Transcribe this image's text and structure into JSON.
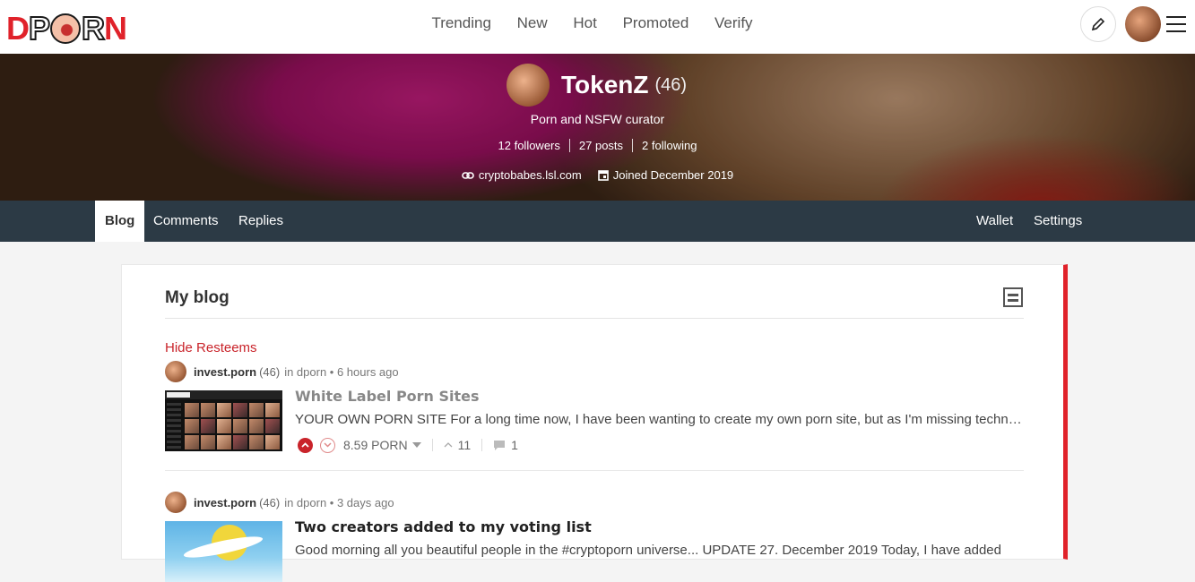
{
  "header": {
    "logo_text": "DPORN",
    "nav": [
      "Trending",
      "New",
      "Hot",
      "Promoted",
      "Verify"
    ],
    "compose_icon": "pencil-icon",
    "menu_icon": "hamburger-icon"
  },
  "profile": {
    "name": "TokenZ",
    "reputation": "(46)",
    "about": "Porn and NSFW curator",
    "followers": "12 followers",
    "posts": "27 posts",
    "following": "2 following",
    "website": "cryptobabes.lsl.com",
    "joined": "Joined December 2019"
  },
  "tabs": {
    "left": [
      "Blog",
      "Comments",
      "Replies"
    ],
    "right": [
      "Wallet",
      "Settings"
    ],
    "active": "Blog"
  },
  "blog": {
    "title": "My blog",
    "hide_resteems": "Hide Resteems",
    "posts": [
      {
        "author": "invest.porn",
        "reputation": "(46)",
        "meta": "in dporn • 6 hours ago",
        "title": "White Label Porn Sites",
        "body": "YOUR OWN PORN SITE For a long time now, I have been wanting to create my own porn site, but as I'm missing technical skills and money, that has been a distant dream.",
        "payout": "8.59 PORN",
        "votes": "11",
        "replies": "1"
      },
      {
        "author": "invest.porn",
        "reputation": "(46)",
        "meta": "in dporn • 3 days ago",
        "title": "Two creators added to my voting list",
        "body": "Good morning all you beautiful people in the #cryptoporn universe... UPDATE 27. December 2019 Today, I have added"
      }
    ]
  },
  "colors": {
    "brand_red": "#e0222a",
    "tab_bar": "#2c3a45",
    "link_red": "#c9232a"
  }
}
